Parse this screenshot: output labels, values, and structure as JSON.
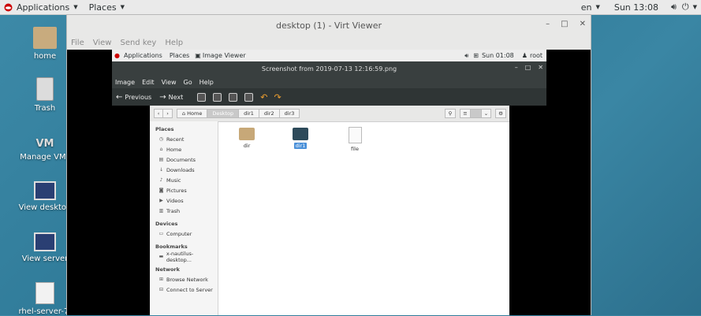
{
  "topbar": {
    "applications": "Applications",
    "places": "Places",
    "lang": "en",
    "clock": "Sun 13:08",
    "volume_icon": "volume-icon",
    "power_icon": "power-icon"
  },
  "desktop_icons": [
    {
      "label": "home"
    },
    {
      "label": "Trash"
    },
    {
      "label": "Manage VMs"
    },
    {
      "label": "View desktop"
    },
    {
      "label": "View server"
    },
    {
      "label": "rhel-server-7."
    }
  ],
  "virt_viewer": {
    "title": "desktop (1) - Virt Viewer",
    "menu": [
      "File",
      "View",
      "Send key",
      "Help"
    ]
  },
  "guest_topbar": {
    "applications": "Applications",
    "places": "Places",
    "app": "Image Viewer",
    "clock": "Sun 01:08",
    "user": "root"
  },
  "image_viewer": {
    "title": "Screenshot from 2019-07-13 12:16:59.png",
    "menu": [
      "Image",
      "Edit",
      "View",
      "Go",
      "Help"
    ],
    "previous": "Previous",
    "next": "Next"
  },
  "nautilus": {
    "crumbs": [
      "Home",
      "Desktop",
      "dir1",
      "dir2",
      "dir3"
    ],
    "places_header": "Places",
    "places": [
      "Recent",
      "Home",
      "Documents",
      "Downloads",
      "Music",
      "Pictures",
      "Videos",
      "Trash"
    ],
    "devices_header": "Devices",
    "devices": [
      "Computer"
    ],
    "bookmarks_header": "Bookmarks",
    "bookmarks": [
      "x-nautilus-desktop..."
    ],
    "network_header": "Network",
    "network": [
      "Browse Network",
      "Connect to Server"
    ],
    "files": [
      {
        "name": "dir",
        "type": "folder",
        "selected": false
      },
      {
        "name": "dir1",
        "type": "folder",
        "selected": true
      },
      {
        "name": "file",
        "type": "file",
        "selected": false
      }
    ]
  },
  "colors": {
    "accent": "#4a90d9",
    "folder": "#c7a878",
    "folder_selected": "#2d4a5a"
  }
}
